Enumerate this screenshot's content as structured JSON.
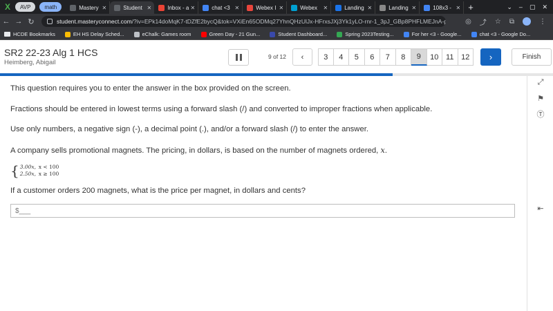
{
  "browser": {
    "pills": [
      "AVP",
      "math"
    ],
    "tabs": [
      {
        "label": "Mastery",
        "icon": "masteryconnect-icon",
        "color": "#5f6368",
        "active": false
      },
      {
        "label": "Student",
        "icon": "masteryconnect-icon",
        "color": "#5f6368",
        "active": true
      },
      {
        "label": "Inbox - a",
        "icon": "gmail-icon",
        "color": "#ea4335",
        "active": false
      },
      {
        "label": "chat <3",
        "icon": "google-docs-icon",
        "color": "#4285f4",
        "active": false
      },
      {
        "label": "Webex I",
        "icon": "webex-icon",
        "color": "#e8453c",
        "active": false
      },
      {
        "label": "Webex",
        "icon": "webex-icon",
        "color": "#00a0d1",
        "active": false
      },
      {
        "label": "Landing",
        "icon": "landing-icon",
        "color": "#1a73e8",
        "active": false
      },
      {
        "label": "Landing",
        "icon": "landing-icon",
        "color": "#888888",
        "active": false
      },
      {
        "label": "108x3 -",
        "icon": "google-icon",
        "color": "#4285f4",
        "active": false
      }
    ],
    "url_host": "student.masteryconnect.com",
    "url_rest": "/?iv=EPk14doMqK7-tDZfE2bycQ&tok=VXiEn65ODMq27YhnQHzUlJx-HFrxsJXj3Yk1yLO-rnr-1_3pJ_GBp8PHFLMEJnA-pXi...",
    "bookmarks": [
      {
        "label": "HCDE Bookmarks",
        "icon": "folder-icon",
        "color": "#e8eaed"
      },
      {
        "label": "EH HS Delay Sched...",
        "icon": "google-drive-icon",
        "color": "#fbbc04"
      },
      {
        "label": "eChalk: Games room",
        "icon": "globe-icon",
        "color": "#bdc1c6"
      },
      {
        "label": "Green Day - 21 Gun...",
        "icon": "youtube-icon",
        "color": "#ff0000"
      },
      {
        "label": "Student Dashboard...",
        "icon": "dashboard-icon",
        "color": "#3949ab"
      },
      {
        "label": "Spring 2023Testing...",
        "icon": "google-drive-icon",
        "color": "#34a853"
      },
      {
        "label": "For her <3 - Google...",
        "icon": "google-docs-icon",
        "color": "#4285f4"
      },
      {
        "label": "chat <3 - Google Do...",
        "icon": "google-docs-icon",
        "color": "#4285f4"
      }
    ]
  },
  "header": {
    "course": "SR2 22-23 Alg 1 HCS",
    "student": "Heimberg, Abigail",
    "progress_text": "9 of 12",
    "pages": [
      "3",
      "4",
      "5",
      "6",
      "7",
      "8",
      "9",
      "10",
      "11",
      "12"
    ],
    "current_page": "9",
    "finish_label": "Finish",
    "progress_fraction": 0.71
  },
  "question": {
    "instruction1": "This question requires you to enter the answer in the box provided on the screen.",
    "instruction2": "Fractions should be entered in lowest terms using a forward slash (/) and converted to improper fractions when applicable.",
    "instruction3": "Use only numbers, a negative sign (-), a decimal point (.), and/or a forward slash (/) to enter the answer.",
    "stem": "A company sells promotional magnets. The pricing, in dollars, is based on the number of magnets ordered,",
    "variable": "x",
    "stem_end": ".",
    "cases": [
      {
        "value": "3.00x,",
        "condition": "x < 100"
      },
      {
        "value": "2.50x,",
        "condition": "x ≥ 100"
      }
    ],
    "prompt": "If a customer orders 200 magnets, what is the price per magnet, in dollars and cents?",
    "answer_placeholder": "$___"
  },
  "colors": {
    "accent": "#1565c0",
    "browser_dark": "#202124"
  }
}
